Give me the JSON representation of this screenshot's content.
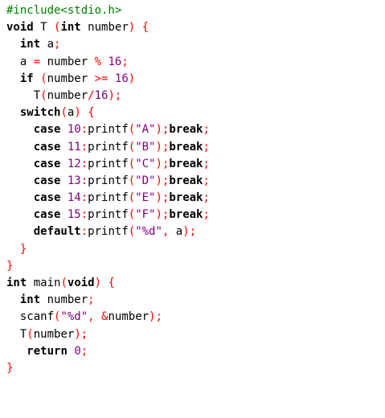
{
  "colors": {
    "background": "#ffffff",
    "preprocessor": "#008000",
    "keyword": "#000000",
    "number_and_string": "#800080",
    "operator_and_punctuation": "#ff0000",
    "identifier": "#000000"
  },
  "lines": [
    [
      {
        "t": "#include<stdio.h>",
        "c": "pp"
      }
    ],
    [
      {
        "t": "void",
        "c": "kw"
      },
      {
        "t": " T ",
        "c": "id"
      },
      {
        "t": "(",
        "c": "op"
      },
      {
        "t": "int",
        "c": "kw"
      },
      {
        "t": " number",
        "c": "id"
      },
      {
        "t": ")",
        "c": "op"
      },
      {
        "t": " ",
        "c": "id"
      },
      {
        "t": "{",
        "c": "op"
      }
    ],
    [
      {
        "t": "  ",
        "c": "ws"
      },
      {
        "t": "int",
        "c": "kw"
      },
      {
        "t": " a",
        "c": "id"
      },
      {
        "t": ";",
        "c": "op"
      }
    ],
    [
      {
        "t": "  ",
        "c": "ws"
      },
      {
        "t": "a ",
        "c": "id"
      },
      {
        "t": "=",
        "c": "op"
      },
      {
        "t": " number ",
        "c": "id"
      },
      {
        "t": "%",
        "c": "op"
      },
      {
        "t": " ",
        "c": "id"
      },
      {
        "t": "16",
        "c": "num"
      },
      {
        "t": ";",
        "c": "op"
      }
    ],
    [
      {
        "t": "  ",
        "c": "ws"
      },
      {
        "t": "if",
        "c": "kw"
      },
      {
        "t": " ",
        "c": "id"
      },
      {
        "t": "(",
        "c": "op"
      },
      {
        "t": "number ",
        "c": "id"
      },
      {
        "t": ">=",
        "c": "op"
      },
      {
        "t": " ",
        "c": "id"
      },
      {
        "t": "16",
        "c": "num"
      },
      {
        "t": ")",
        "c": "op"
      }
    ],
    [
      {
        "t": "    ",
        "c": "ws"
      },
      {
        "t": "T",
        "c": "id"
      },
      {
        "t": "(",
        "c": "op"
      },
      {
        "t": "number",
        "c": "id"
      },
      {
        "t": "/",
        "c": "op"
      },
      {
        "t": "16",
        "c": "num"
      },
      {
        "t": ");",
        "c": "op"
      }
    ],
    [
      {
        "t": "  ",
        "c": "ws"
      },
      {
        "t": "switch",
        "c": "kw"
      },
      {
        "t": "(",
        "c": "op"
      },
      {
        "t": "a",
        "c": "id"
      },
      {
        "t": ")",
        "c": "op"
      },
      {
        "t": " ",
        "c": "id"
      },
      {
        "t": "{",
        "c": "op"
      }
    ],
    [
      {
        "t": "    ",
        "c": "ws"
      },
      {
        "t": "case",
        "c": "kw"
      },
      {
        "t": " ",
        "c": "id"
      },
      {
        "t": "10",
        "c": "num"
      },
      {
        "t": ":",
        "c": "op"
      },
      {
        "t": "printf",
        "c": "id"
      },
      {
        "t": "(",
        "c": "op"
      },
      {
        "t": "\"A\"",
        "c": "str"
      },
      {
        "t": ");",
        "c": "op"
      },
      {
        "t": "break",
        "c": "kw"
      },
      {
        "t": ";",
        "c": "op"
      }
    ],
    [
      {
        "t": "    ",
        "c": "ws"
      },
      {
        "t": "case",
        "c": "kw"
      },
      {
        "t": " ",
        "c": "id"
      },
      {
        "t": "11",
        "c": "num"
      },
      {
        "t": ":",
        "c": "op"
      },
      {
        "t": "printf",
        "c": "id"
      },
      {
        "t": "(",
        "c": "op"
      },
      {
        "t": "\"B\"",
        "c": "str"
      },
      {
        "t": ");",
        "c": "op"
      },
      {
        "t": "break",
        "c": "kw"
      },
      {
        "t": ";",
        "c": "op"
      }
    ],
    [
      {
        "t": "    ",
        "c": "ws"
      },
      {
        "t": "case",
        "c": "kw"
      },
      {
        "t": " ",
        "c": "id"
      },
      {
        "t": "12",
        "c": "num"
      },
      {
        "t": ":",
        "c": "op"
      },
      {
        "t": "printf",
        "c": "id"
      },
      {
        "t": "(",
        "c": "op"
      },
      {
        "t": "\"C\"",
        "c": "str"
      },
      {
        "t": ");",
        "c": "op"
      },
      {
        "t": "break",
        "c": "kw"
      },
      {
        "t": ";",
        "c": "op"
      }
    ],
    [
      {
        "t": "    ",
        "c": "ws"
      },
      {
        "t": "case",
        "c": "kw"
      },
      {
        "t": " ",
        "c": "id"
      },
      {
        "t": "13",
        "c": "num"
      },
      {
        "t": ":",
        "c": "op"
      },
      {
        "t": "printf",
        "c": "id"
      },
      {
        "t": "(",
        "c": "op"
      },
      {
        "t": "\"D\"",
        "c": "str"
      },
      {
        "t": ");",
        "c": "op"
      },
      {
        "t": "break",
        "c": "kw"
      },
      {
        "t": ";",
        "c": "op"
      }
    ],
    [
      {
        "t": "    ",
        "c": "ws"
      },
      {
        "t": "case",
        "c": "kw"
      },
      {
        "t": " ",
        "c": "id"
      },
      {
        "t": "14",
        "c": "num"
      },
      {
        "t": ":",
        "c": "op"
      },
      {
        "t": "printf",
        "c": "id"
      },
      {
        "t": "(",
        "c": "op"
      },
      {
        "t": "\"E\"",
        "c": "str"
      },
      {
        "t": ");",
        "c": "op"
      },
      {
        "t": "break",
        "c": "kw"
      },
      {
        "t": ";",
        "c": "op"
      }
    ],
    [
      {
        "t": "    ",
        "c": "ws"
      },
      {
        "t": "case",
        "c": "kw"
      },
      {
        "t": " ",
        "c": "id"
      },
      {
        "t": "15",
        "c": "num"
      },
      {
        "t": ":",
        "c": "op"
      },
      {
        "t": "printf",
        "c": "id"
      },
      {
        "t": "(",
        "c": "op"
      },
      {
        "t": "\"F\"",
        "c": "str"
      },
      {
        "t": ");",
        "c": "op"
      },
      {
        "t": "break",
        "c": "kw"
      },
      {
        "t": ";",
        "c": "op"
      }
    ],
    [
      {
        "t": "    ",
        "c": "ws"
      },
      {
        "t": "default",
        "c": "kw"
      },
      {
        "t": ":",
        "c": "op"
      },
      {
        "t": "printf",
        "c": "id"
      },
      {
        "t": "(",
        "c": "op"
      },
      {
        "t": "\"%d\"",
        "c": "str"
      },
      {
        "t": ",",
        "c": "op"
      },
      {
        "t": " a",
        "c": "id"
      },
      {
        "t": ");",
        "c": "op"
      }
    ],
    [
      {
        "t": "  ",
        "c": "ws"
      },
      {
        "t": "}",
        "c": "op"
      }
    ],
    [
      {
        "t": "}",
        "c": "op"
      }
    ],
    [
      {
        "t": "int",
        "c": "kw"
      },
      {
        "t": " main",
        "c": "id"
      },
      {
        "t": "(",
        "c": "op"
      },
      {
        "t": "void",
        "c": "kw"
      },
      {
        "t": ")",
        "c": "op"
      },
      {
        "t": " ",
        "c": "id"
      },
      {
        "t": "{",
        "c": "op"
      }
    ],
    [
      {
        "t": "  ",
        "c": "ws"
      },
      {
        "t": "int",
        "c": "kw"
      },
      {
        "t": " number",
        "c": "id"
      },
      {
        "t": ";",
        "c": "op"
      }
    ],
    [
      {
        "t": "  ",
        "c": "ws"
      },
      {
        "t": "scanf",
        "c": "id"
      },
      {
        "t": "(",
        "c": "op"
      },
      {
        "t": "\"%d\"",
        "c": "str"
      },
      {
        "t": ",",
        "c": "op"
      },
      {
        "t": " ",
        "c": "id"
      },
      {
        "t": "&",
        "c": "op"
      },
      {
        "t": "number",
        "c": "id"
      },
      {
        "t": ");",
        "c": "op"
      }
    ],
    [
      {
        "t": "  ",
        "c": "ws"
      },
      {
        "t": "T",
        "c": "id"
      },
      {
        "t": "(",
        "c": "op"
      },
      {
        "t": "number",
        "c": "id"
      },
      {
        "t": ");",
        "c": "op"
      }
    ],
    [
      {
        "t": "   ",
        "c": "ws"
      },
      {
        "t": "return",
        "c": "kw"
      },
      {
        "t": " ",
        "c": "id"
      },
      {
        "t": "0",
        "c": "num"
      },
      {
        "t": ";",
        "c": "op"
      }
    ],
    [
      {
        "t": "}",
        "c": "op"
      }
    ]
  ]
}
